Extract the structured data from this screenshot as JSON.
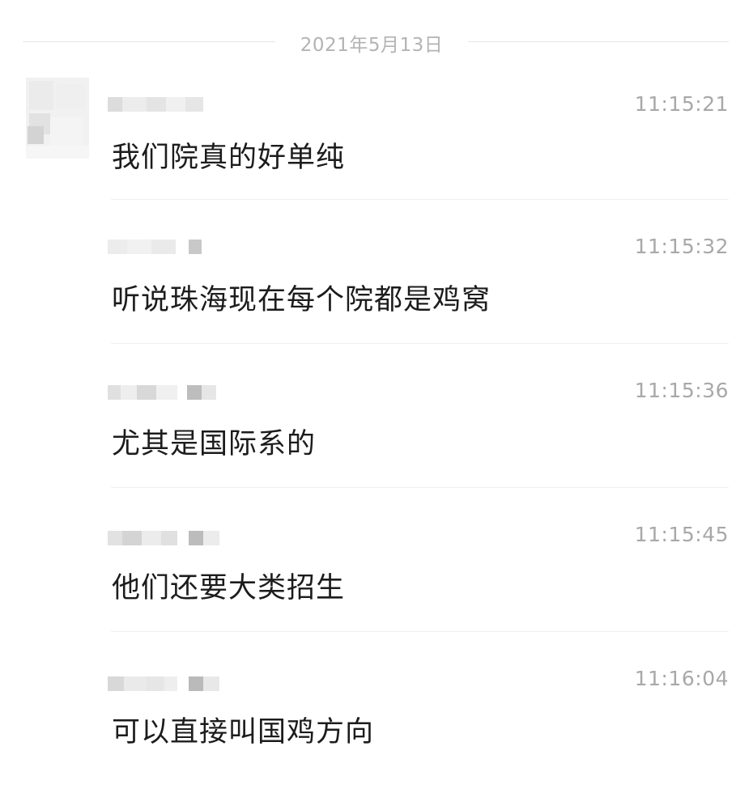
{
  "date_separator": "2021年5月13日",
  "messages": [
    {
      "time": "11:15:21",
      "text": "我们院真的好单纯"
    },
    {
      "time": "11:15:32",
      "text": "听说珠海现在每个院都是鸡窝"
    },
    {
      "time": "11:15:36",
      "text": "尤其是国际系的"
    },
    {
      "time": "11:15:45",
      "text": "他们还要大类招生"
    },
    {
      "time": "11:16:04",
      "text": "可以直接叫国鸡方向"
    }
  ]
}
